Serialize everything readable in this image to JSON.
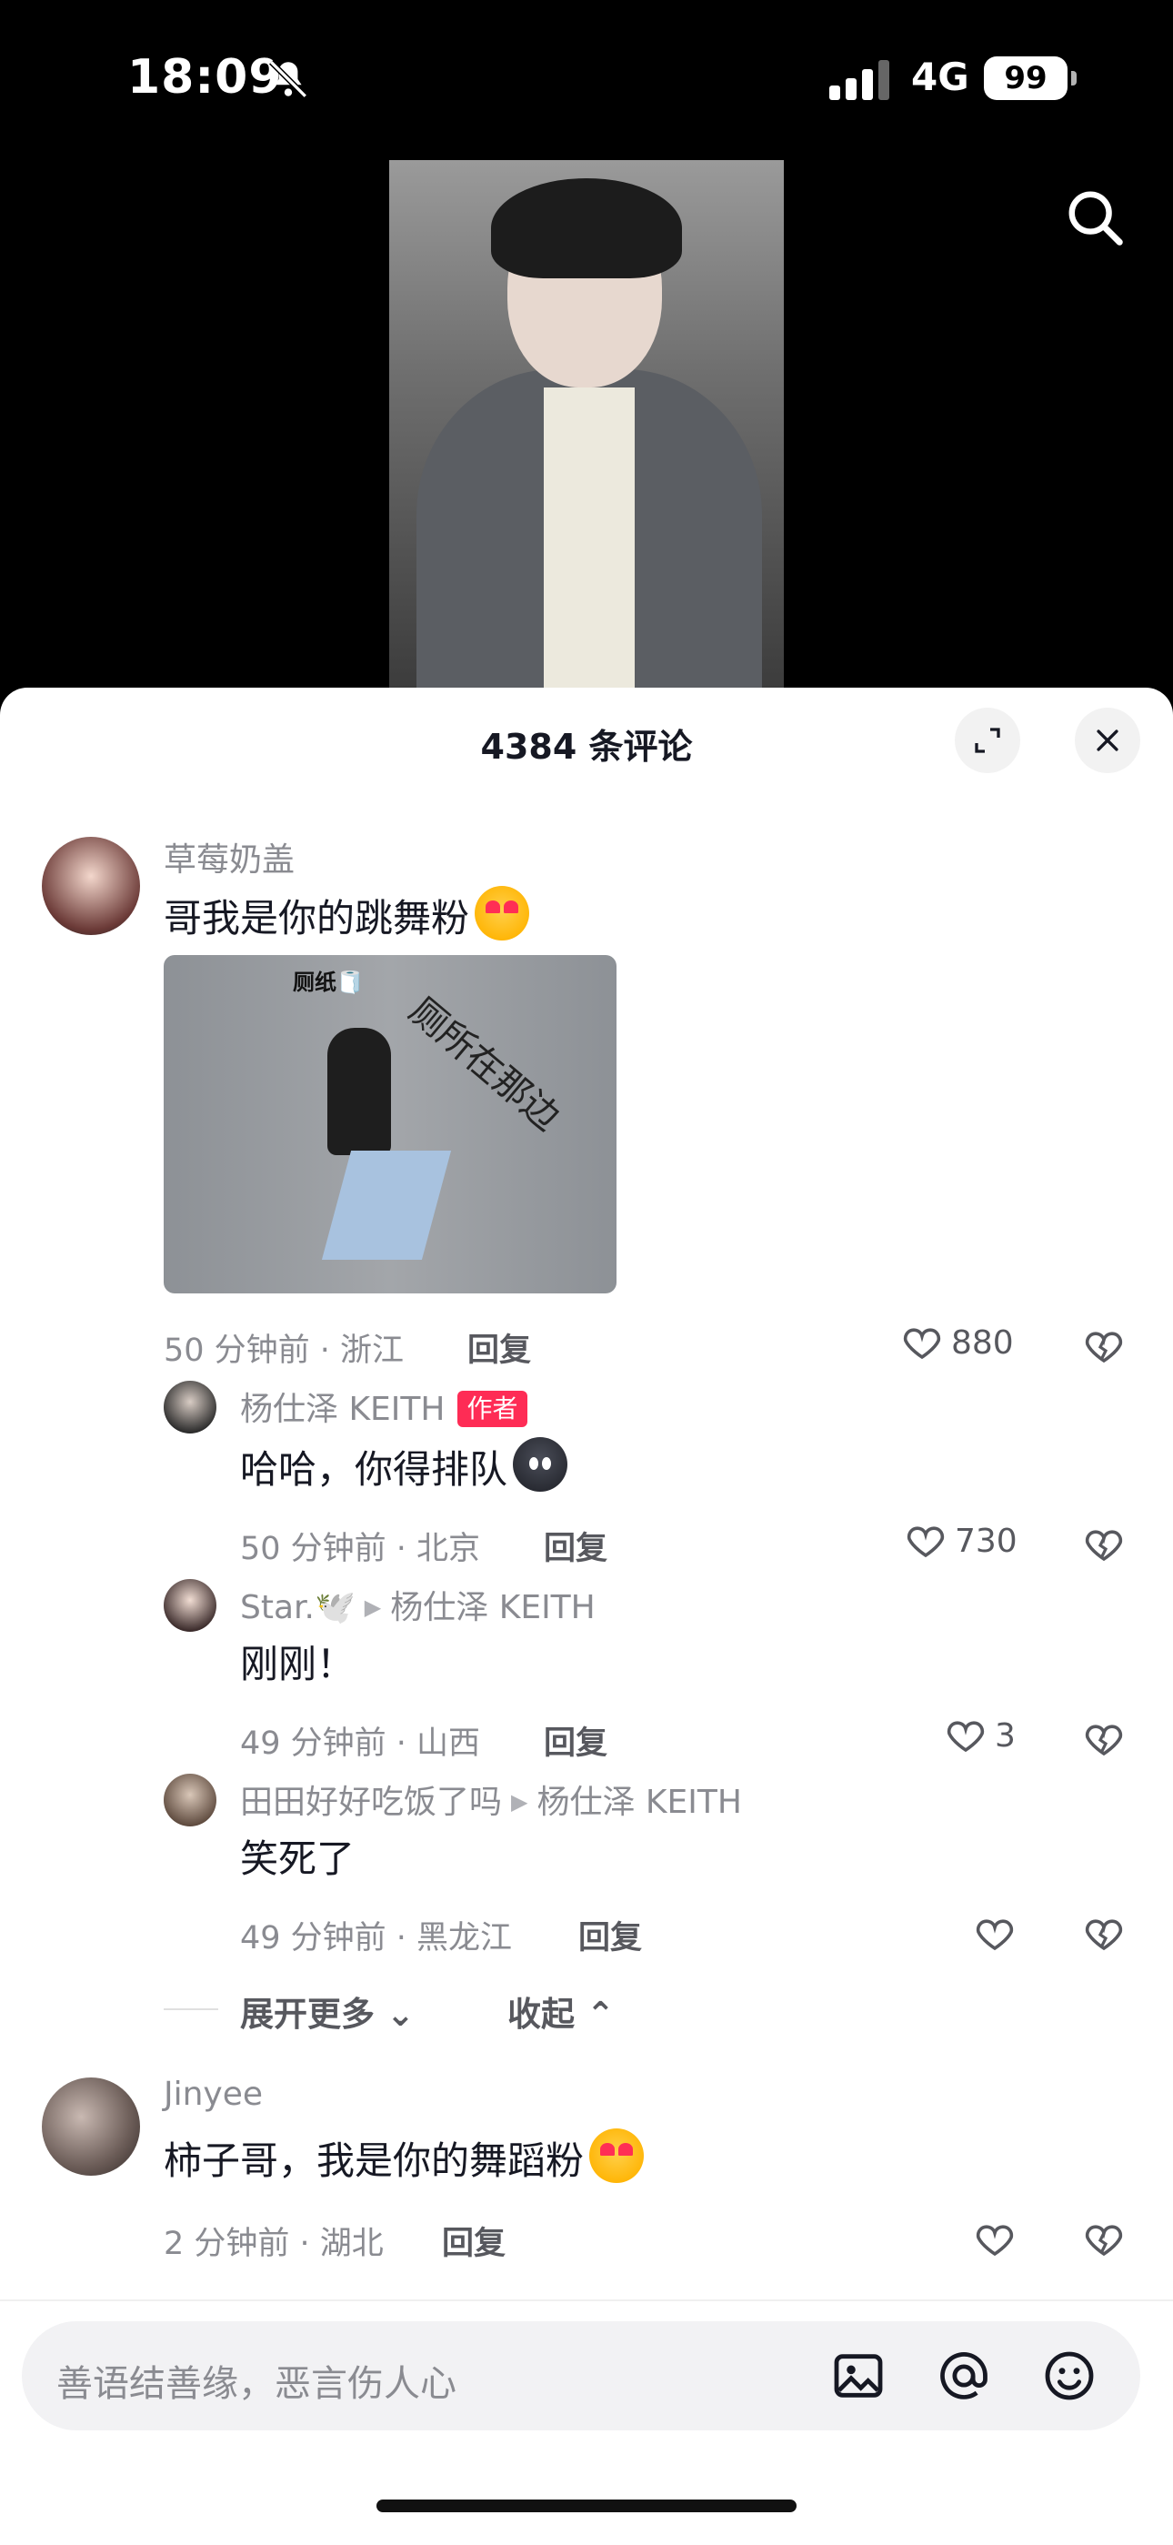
{
  "status_bar": {
    "time": "18:09",
    "network": "4G",
    "battery": "99"
  },
  "panel": {
    "title": "4384 条评论"
  },
  "comments": [
    {
      "user": "草莓奶盖",
      "text": "哥我是你的跳舞粉",
      "image_text": {
        "label1": "厕纸🧻",
        "label2": "厕所在那边"
      },
      "time_location": "50 分钟前 · 浙江",
      "reply_label": "回复",
      "likes": "880",
      "replies": [
        {
          "user": "杨仕泽 KEITH",
          "badge": "作者",
          "text": "哈哈，你得排队",
          "time_location": "50 分钟前 · 北京",
          "reply_label": "回复",
          "likes": "730"
        },
        {
          "user": "Star.🕊️",
          "reply_to": "杨仕泽 KEITH",
          "text": "刚刚！",
          "time_location": "49 分钟前 · 山西",
          "reply_label": "回复",
          "likes": "3"
        },
        {
          "user": "田田好好吃饭了吗",
          "reply_to": "杨仕泽 KEITH",
          "text": "笑死了",
          "time_location": "49 分钟前 · 黑龙江",
          "reply_label": "回复",
          "likes": ""
        }
      ],
      "expand_more": "展开更多",
      "collapse": "收起"
    },
    {
      "user": "Jinyee",
      "text": "柿子哥，我是你的舞蹈粉",
      "time_location": "2 分钟前 · 湖北",
      "reply_label": "回复",
      "likes": ""
    }
  ],
  "input": {
    "placeholder": "善语结善缘，恶言伤人心"
  },
  "colors": {
    "accent": "#fe2c55",
    "panel_bg": "#ffffff",
    "text_secondary": "#8a8b91"
  }
}
